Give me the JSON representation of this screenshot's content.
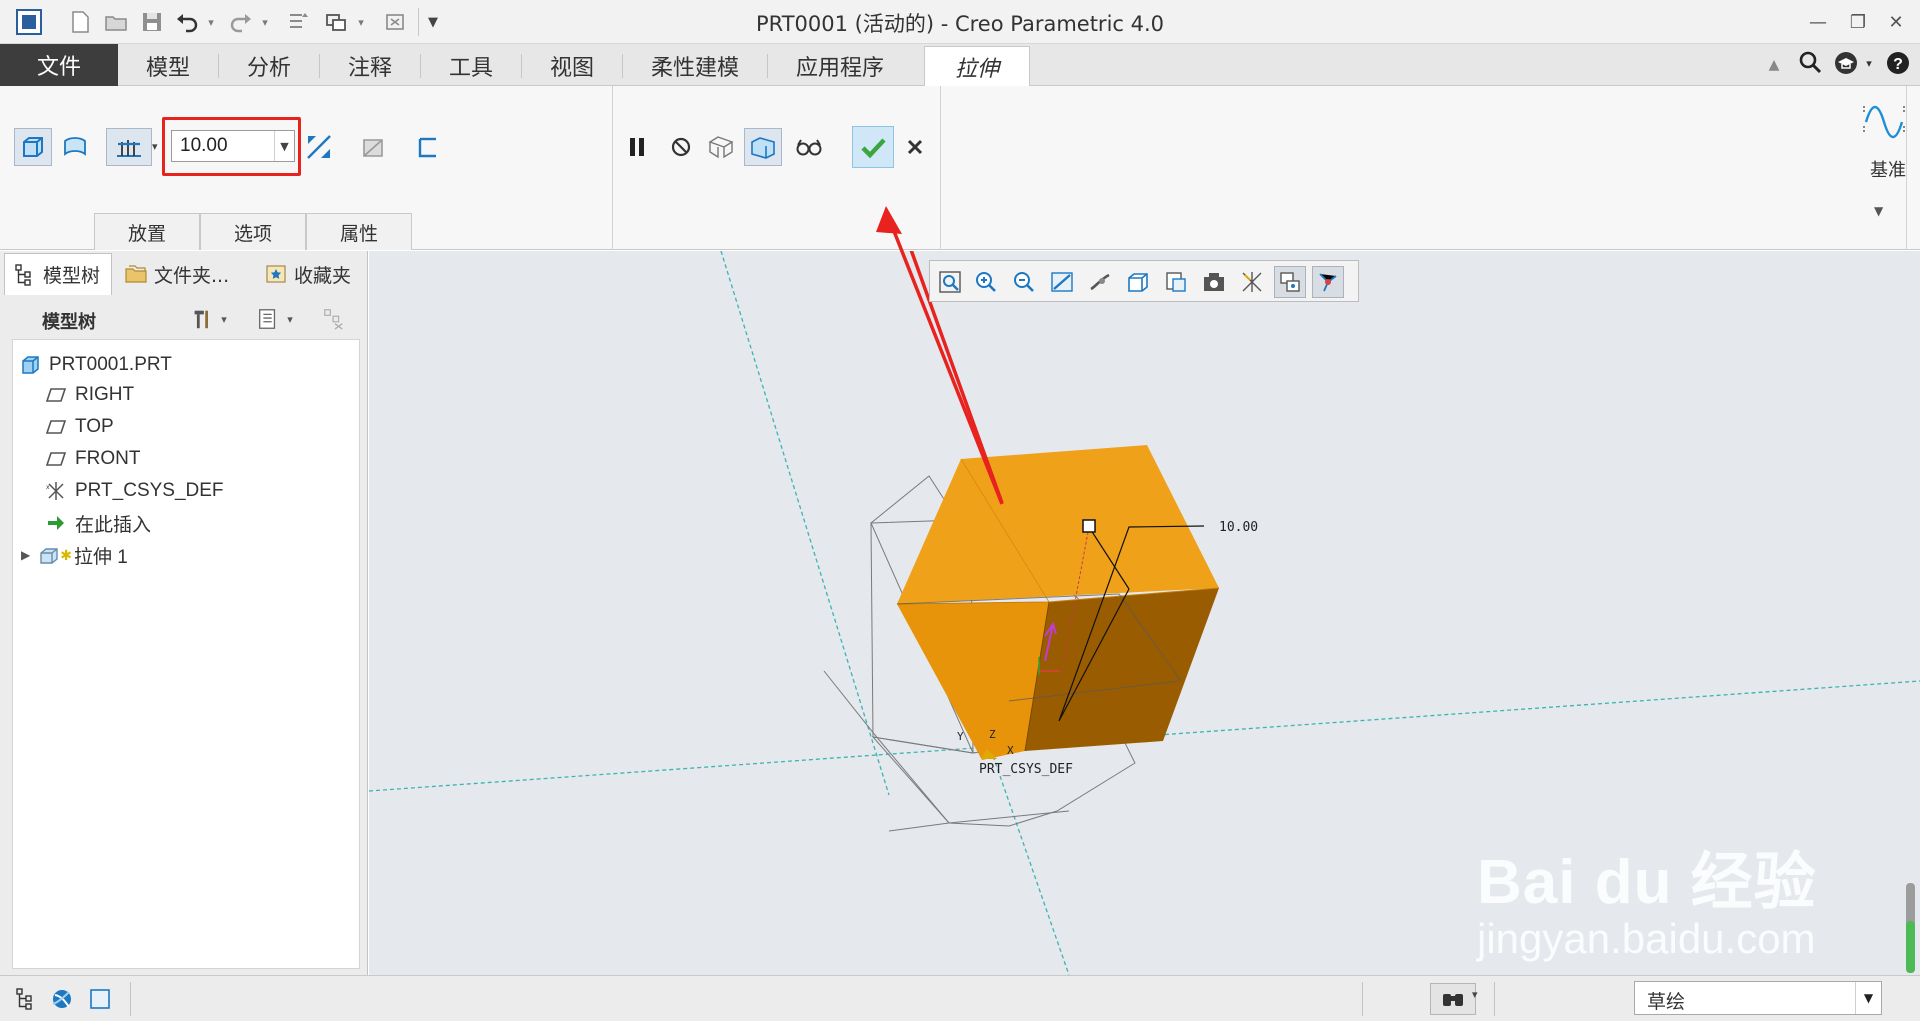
{
  "window": {
    "title": "PRT0001 (活动的) - Creo Parametric 4.0",
    "minimize_glyph": "—",
    "restore_glyph": "❐",
    "close_glyph": "✕"
  },
  "ribbon": {
    "tabs": [
      {
        "label": "文件"
      },
      {
        "label": "模型"
      },
      {
        "label": "分析"
      },
      {
        "label": "注释"
      },
      {
        "label": "工具"
      },
      {
        "label": "视图"
      },
      {
        "label": "柔性建模"
      },
      {
        "label": "应用程序"
      },
      {
        "label": "拉伸"
      }
    ],
    "active_tab": "拉伸",
    "depth_value": "10.00",
    "slideup_tabs": [
      "放置",
      "选项",
      "属性"
    ],
    "datum_label": "基准",
    "accent_ok": "#3aa63d",
    "highlight_color": "#e8221f"
  },
  "left_panel": {
    "tabs": [
      "模型树",
      "文件夹...",
      "收藏夹"
    ],
    "tree_title": "模型树",
    "tree_items": [
      {
        "label": "PRT0001.PRT",
        "icon": "part-icon"
      },
      {
        "label": "RIGHT",
        "icon": "datum-plane-icon"
      },
      {
        "label": "TOP",
        "icon": "datum-plane-icon"
      },
      {
        "label": "FRONT",
        "icon": "datum-plane-icon"
      },
      {
        "label": "PRT_CSYS_DEF",
        "icon": "csys-icon"
      },
      {
        "label": "在此插入",
        "icon": "insert-arrow-icon"
      },
      {
        "label": "拉伸 1",
        "icon": "extrude-feature-icon"
      }
    ]
  },
  "viewport": {
    "dimension_label": "10.00",
    "csys_label": "PRT_CSYS_DEF",
    "axis_x_label": "X",
    "axis_y_label": "Y",
    "axis_z_label": "Z",
    "solid_color": "#e8940a",
    "solid_dark_color": "#9a5c00",
    "watermark": "Bai du 经验",
    "watermark_url": "jingyan.baidu.com"
  },
  "status_bar": {
    "filter_value": "草绘"
  }
}
